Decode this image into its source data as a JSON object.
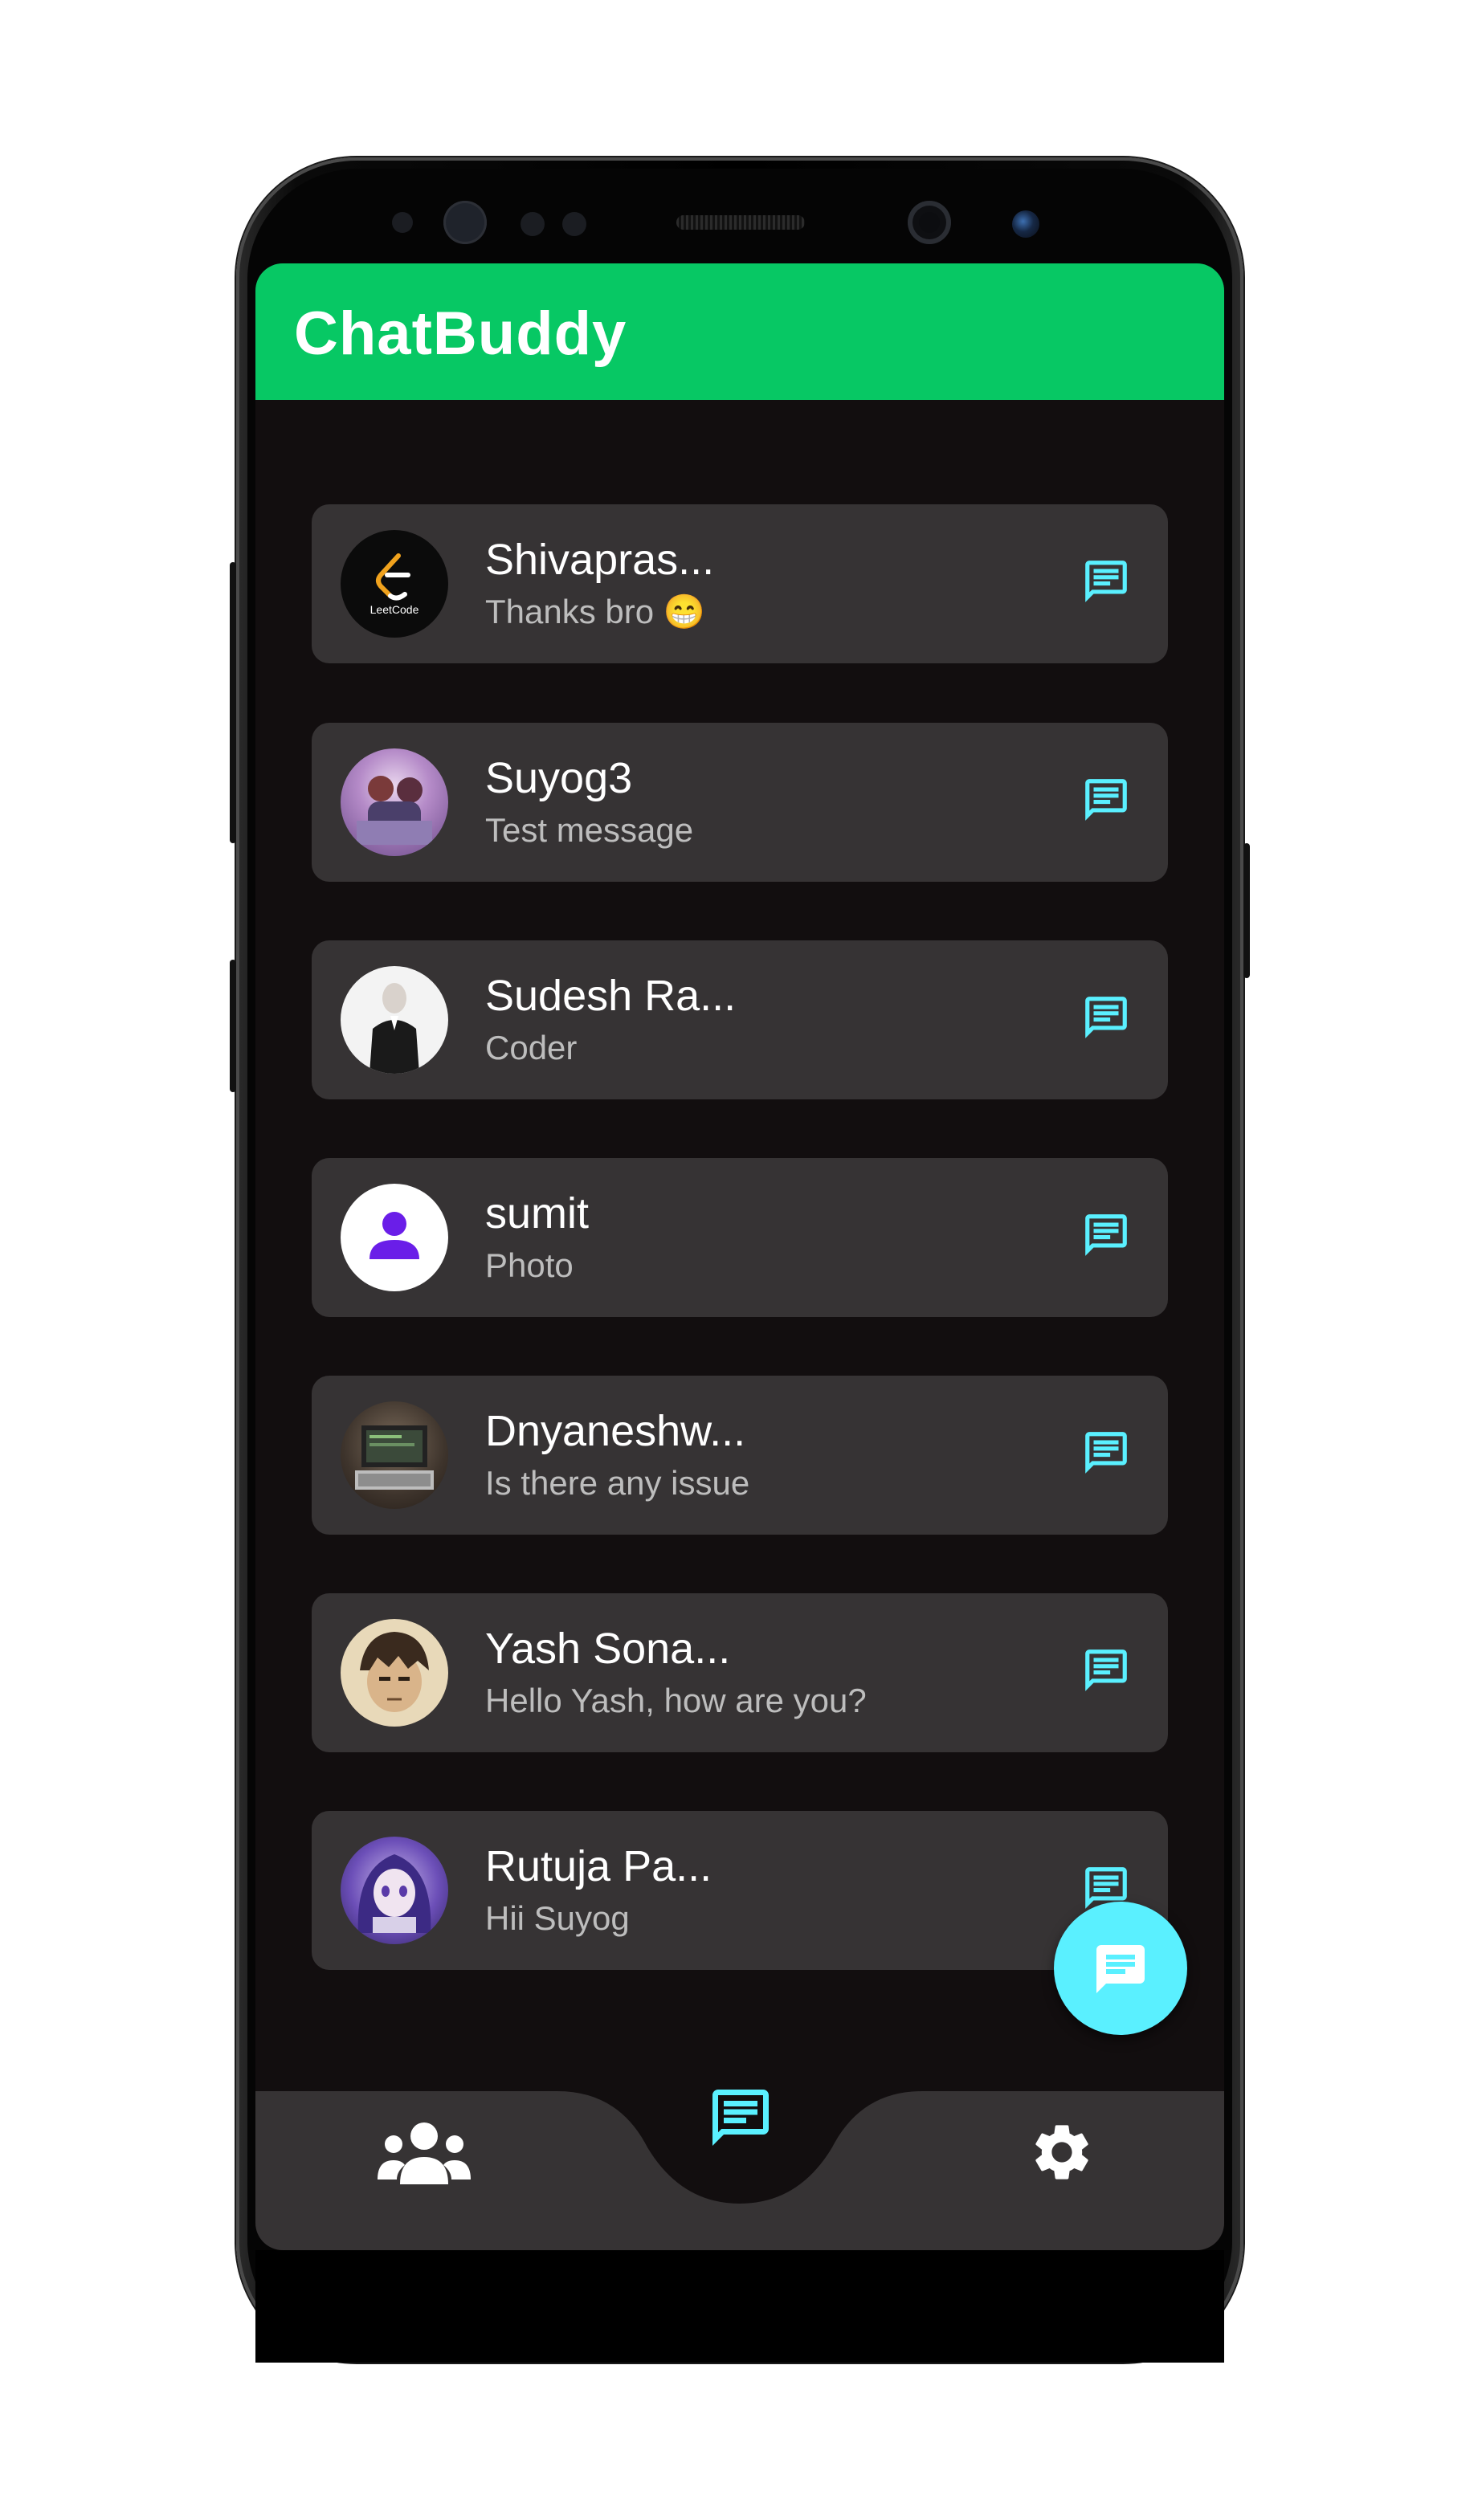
{
  "app": {
    "title": "ChatBuddy",
    "colors": {
      "appbar": "#07c864",
      "background": "#120e0f",
      "card": "#363334",
      "accent": "#5af0ff"
    }
  },
  "chats": [
    {
      "name": "Shivapras...",
      "message": "Thanks bro 😁",
      "avatar": "leetcode-logo-avatar",
      "avatar_text": "LeetCode"
    },
    {
      "name": "Suyog3",
      "message": "Test message",
      "avatar": "anime-group-avatar"
    },
    {
      "name": "Sudesh Ra...",
      "message": "Coder",
      "avatar": "man-in-suit-avatar"
    },
    {
      "name": "sumit",
      "message": "Photo",
      "avatar": "default-person-avatar"
    },
    {
      "name": "Dnyaneshw...",
      "message": "Is there any issue",
      "avatar": "laptop-photo-avatar"
    },
    {
      "name": "Yash Sona...",
      "message": "Hello Yash, how are you?",
      "avatar": "anime-boy-avatar"
    },
    {
      "name": "Rutuja Pa...",
      "message": "Hii Suyog",
      "avatar": "anime-girl-avatar"
    }
  ],
  "row_action_icon": "chat-icon",
  "fab_icon": "message-icon",
  "bottom_nav": [
    {
      "icon": "people-icon",
      "active": false
    },
    {
      "icon": "chat-icon",
      "active": true
    },
    {
      "icon": "gear-icon",
      "active": false
    }
  ]
}
